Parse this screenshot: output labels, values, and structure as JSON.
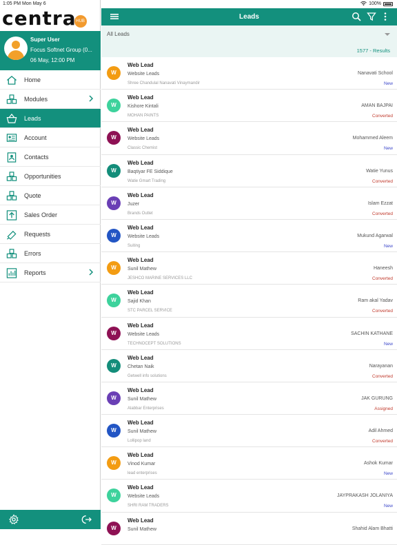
{
  "status": {
    "time": "1:05 PM  Mon May 6",
    "battery": "100%"
  },
  "brand": {
    "logo": "centra",
    "logo_badge": "HUB"
  },
  "user": {
    "name": "Super User",
    "org": "Focus Softnet Group (0...",
    "date": "06 May, 12:00 PM"
  },
  "menu": [
    {
      "label": "Home",
      "icon": "home-icon",
      "chevron": false
    },
    {
      "label": "Modules",
      "icon": "modules-icon",
      "chevron": true
    },
    {
      "label": "Leads",
      "icon": "leads-icon",
      "chevron": false,
      "active": true
    },
    {
      "label": "Account",
      "icon": "account-icon",
      "chevron": false
    },
    {
      "label": "Contacts",
      "icon": "contacts-icon",
      "chevron": false
    },
    {
      "label": "Opportunities",
      "icon": "opportunities-icon",
      "chevron": false
    },
    {
      "label": "Quote",
      "icon": "quote-icon",
      "chevron": false
    },
    {
      "label": "Sales Order",
      "icon": "sales-order-icon",
      "chevron": false
    },
    {
      "label": "Requests",
      "icon": "requests-icon",
      "chevron": false
    },
    {
      "label": "Errors",
      "icon": "errors-icon",
      "chevron": false
    },
    {
      "label": "Reports",
      "icon": "reports-icon",
      "chevron": true
    }
  ],
  "header": {
    "title": "Leads"
  },
  "filter": {
    "selected": "All Leads",
    "results": "1577 - Results"
  },
  "colors": {
    "teal": "#13907d",
    "new": "#3b46c9",
    "converted": "#c0392b",
    "assigned": "#c0392b"
  },
  "leads": [
    {
      "initial": "W",
      "color": "#f39c12",
      "title": "Web Lead",
      "source": "Website Leads",
      "company": "Shree Chandulal Nanavati Vinaymandir",
      "owner": "Nanavati School",
      "status": "New",
      "status_color": "#3b46c9"
    },
    {
      "initial": "W",
      "color": "#3dd29c",
      "title": "Web Lead",
      "source": "Kishore Kintali",
      "company": "MOHAN PAINTS",
      "owner": "AMAN BAJPAI",
      "status": "Converted",
      "status_color": "#c0392b"
    },
    {
      "initial": "W",
      "color": "#8e1154",
      "title": "Web Lead",
      "source": "Website Leads",
      "company": "Classic Chemist",
      "owner": "Mohammed Aleem",
      "status": "New",
      "status_color": "#3b46c9"
    },
    {
      "initial": "W",
      "color": "#138d7a",
      "title": "Web Lead",
      "source": "Baqtiyar FE Siddique",
      "company": "Watie Gmart Trading",
      "owner": "Watie Yunus",
      "status": "Converted",
      "status_color": "#c0392b"
    },
    {
      "initial": "W",
      "color": "#6a3fb5",
      "title": "Web Lead",
      "source": "Juzer",
      "company": "Brands Outlet",
      "owner": "Islam Ezzat",
      "status": "Converted",
      "status_color": "#c0392b"
    },
    {
      "initial": "W",
      "color": "#2255c4",
      "title": "Web Lead",
      "source": "Website Leads",
      "company": "Suiting",
      "owner": "Mukund Agarwal",
      "status": "New",
      "status_color": "#3b46c9"
    },
    {
      "initial": "W",
      "color": "#f39c12",
      "title": "Web Lead",
      "source": "Sunil Mathew",
      "company": "JESHCO MARINE SERVICES LLC",
      "owner": "Haneesh",
      "status": "Converted",
      "status_color": "#c0392b"
    },
    {
      "initial": "W",
      "color": "#3dd29c",
      "title": "Web Lead",
      "source": "Sajid Khan",
      "company": "STC PARCEL SERVICE",
      "owner": "Ram akal Yadav",
      "status": "Converted",
      "status_color": "#c0392b"
    },
    {
      "initial": "W",
      "color": "#8e1154",
      "title": "Web Lead",
      "source": "Website Leads",
      "company": "TECHNOCEPT SOLUTIONS",
      "owner": "SACHIN KATHANE",
      "status": "New",
      "status_color": "#3b46c9"
    },
    {
      "initial": "W",
      "color": "#138d7a",
      "title": "Web Lead",
      "source": "Chetan Naik",
      "company": "Getwell info solutions",
      "owner": "Narayanan",
      "status": "Converted",
      "status_color": "#c0392b"
    },
    {
      "initial": "W",
      "color": "#6a3fb5",
      "title": "Web Lead",
      "source": "Sunil Mathew",
      "company": "Alabbar Enterprises",
      "owner": "JAK GURUNG",
      "status": "Assigned",
      "status_color": "#c0392b"
    },
    {
      "initial": "W",
      "color": "#2255c4",
      "title": "Web Lead",
      "source": "Sunil Mathew",
      "company": "Lollipop land",
      "owner": "Adil Ahmed",
      "status": "Converted",
      "status_color": "#c0392b"
    },
    {
      "initial": "W",
      "color": "#f39c12",
      "title": "Web Lead",
      "source": "Vinod Kumar",
      "company": "lead enterprises",
      "owner": "Ashok Kumar",
      "status": "New",
      "status_color": "#3b46c9"
    },
    {
      "initial": "W",
      "color": "#3dd29c",
      "title": "Web Lead",
      "source": "Website Leads",
      "company": "SHRI RAM TRADERS",
      "owner": "JAYPRAKASH JOLANIYA",
      "status": "New",
      "status_color": "#3b46c9"
    },
    {
      "initial": "W",
      "color": "#8e1154",
      "title": "Web Lead",
      "source": "Sunil Mathew",
      "company": "",
      "owner": "Shahid Alam Bhatti",
      "status": "",
      "status_color": "#3b46c9"
    }
  ]
}
